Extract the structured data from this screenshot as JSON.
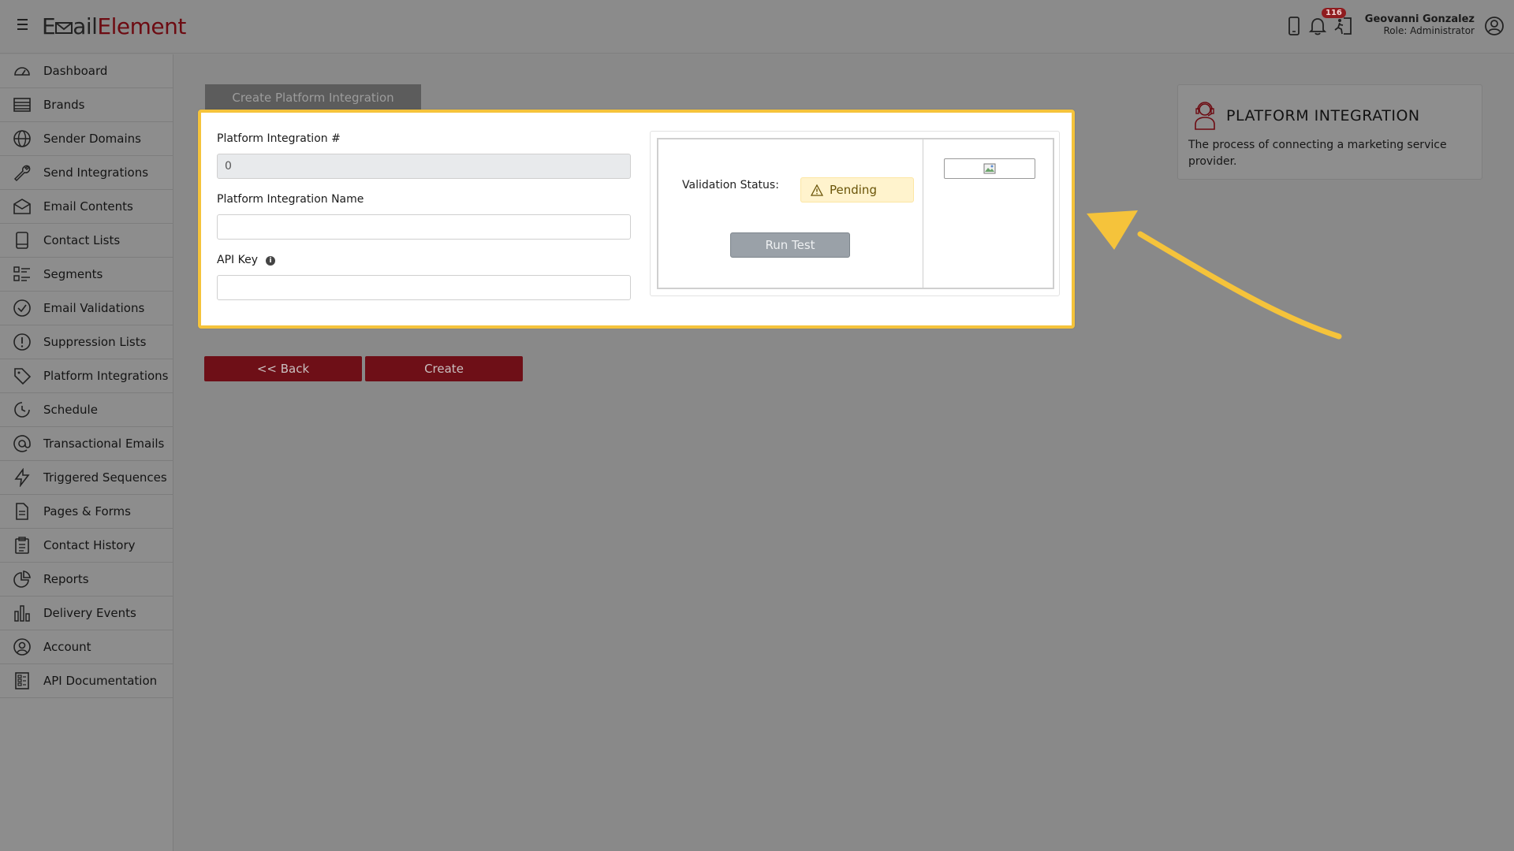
{
  "header": {
    "logo_part1": "E",
    "logo_part2": "ail",
    "logo_part3": "Element",
    "notification_count": "116",
    "user_name": "Geovanni Gonzalez",
    "user_role": "Role: Administrator"
  },
  "sidebar": {
    "items": [
      {
        "label": "Dashboard",
        "icon": "dashboard-icon"
      },
      {
        "label": "Brands",
        "icon": "brands-icon"
      },
      {
        "label": "Sender Domains",
        "icon": "globe-icon"
      },
      {
        "label": "Send Integrations",
        "icon": "wrench-icon"
      },
      {
        "label": "Email Contents",
        "icon": "envelope-icon"
      },
      {
        "label": "Contact Lists",
        "icon": "book-icon"
      },
      {
        "label": "Segments",
        "icon": "list-icon"
      },
      {
        "label": "Email Validations",
        "icon": "check-circle-icon"
      },
      {
        "label": "Suppression Lists",
        "icon": "exclamation-circle-icon"
      },
      {
        "label": "Platform Integrations",
        "icon": "tag-icon"
      },
      {
        "label": "Schedule",
        "icon": "clock-icon"
      },
      {
        "label": "Transactional Emails",
        "icon": "at-icon"
      },
      {
        "label": "Triggered Sequences",
        "icon": "lightning-icon"
      },
      {
        "label": "Pages & Forms",
        "icon": "document-icon"
      },
      {
        "label": "Contact History",
        "icon": "clipboard-icon"
      },
      {
        "label": "Reports",
        "icon": "pie-chart-icon"
      },
      {
        "label": "Delivery Events",
        "icon": "bar-chart-icon"
      },
      {
        "label": "Account",
        "icon": "user-circle-icon"
      },
      {
        "label": "API Documentation",
        "icon": "api-doc-icon"
      }
    ]
  },
  "main": {
    "tab_label": "Create Platform Integration",
    "form": {
      "number_label": "Platform Integration #",
      "number_value": "0",
      "name_label": "Platform Integration Name",
      "name_value": "",
      "api_key_label": "API Key",
      "api_key_value": ""
    },
    "validation": {
      "status_label": "Validation Status:",
      "status_value": "Pending",
      "run_test_label": "Run Test"
    },
    "back_label": "<< Back",
    "create_label": "Create"
  },
  "info_card": {
    "title": "PLATFORM INTEGRATION",
    "text": "The process of connecting a marketing service provider."
  },
  "colors": {
    "highlight": "#f5c33b",
    "brand_red": "#6e0f17",
    "pending_bg": "#fff3cd"
  }
}
